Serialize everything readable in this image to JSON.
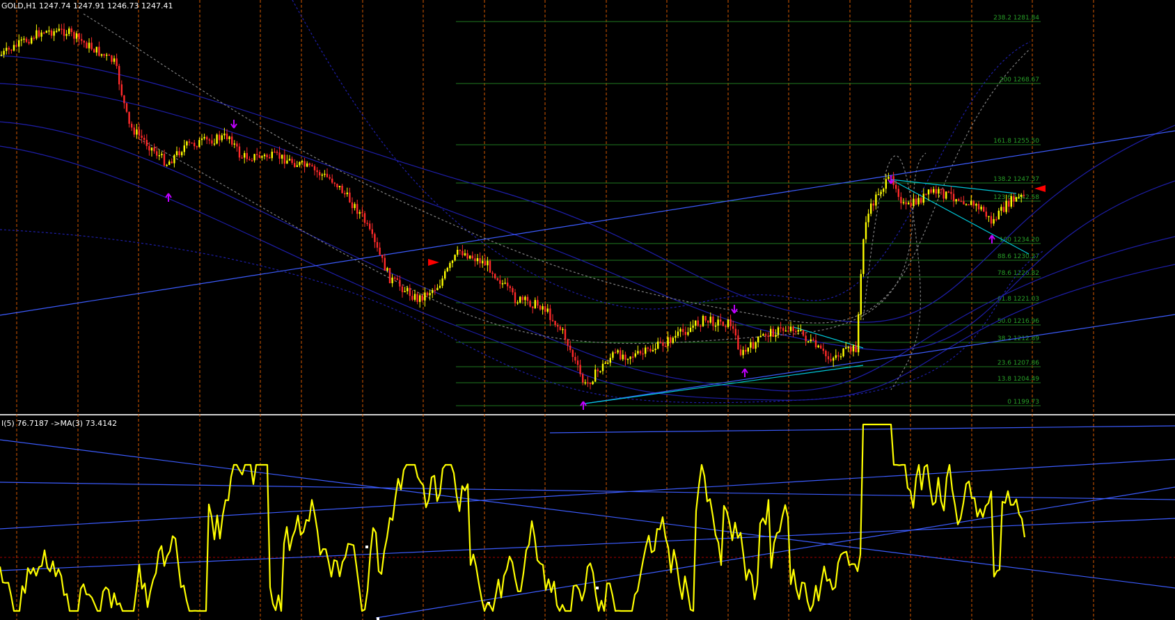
{
  "window": {
    "symbol_header": "GOLD,H1  1247.74 1247.91 1246.73 1247.41",
    "indicator_header": "I(5) 76.7187  ->MA(3) 73.4142"
  },
  "colors": {
    "background": "#000000",
    "candle_up": "#ffff00",
    "candle_down": "#ff2a2a",
    "fib_lines": "#1f7a1f",
    "fib_text": "#28a028",
    "trend_lines": "#3c5cff",
    "envelope": "#1e1ea8",
    "gray_dashed": "#808080",
    "cyan_lines": "#00c8d8",
    "vertical_sep": "#ff6a00",
    "oscillator": "#ffff00",
    "arrow_marker": "#c000ff",
    "red_marker": "#ff0000"
  },
  "fibonacci_levels": [
    {
      "text": "238.2 1281.84"
    },
    {
      "text": "200 1268.67"
    },
    {
      "text": "161.8 1255.50"
    },
    {
      "text": "138.2 1247.37"
    },
    {
      "text": "123.6 1242.58"
    },
    {
      "text": "100 1234.20"
    },
    {
      "text": "88.6 1230.27"
    },
    {
      "text": "78.6 1226.82"
    },
    {
      "text": "61.8 1221.03"
    },
    {
      "text": "50.0 1216.96"
    },
    {
      "text": "38.2 1212.89"
    },
    {
      "text": "23.6 1207.86"
    },
    {
      "text": "13.8 1204.49"
    },
    {
      "text": "0 1199.73"
    }
  ],
  "icons": {
    "fractal_arrow": "purple-arrow-icon",
    "signal_marker": "red-arrow-icon"
  }
}
